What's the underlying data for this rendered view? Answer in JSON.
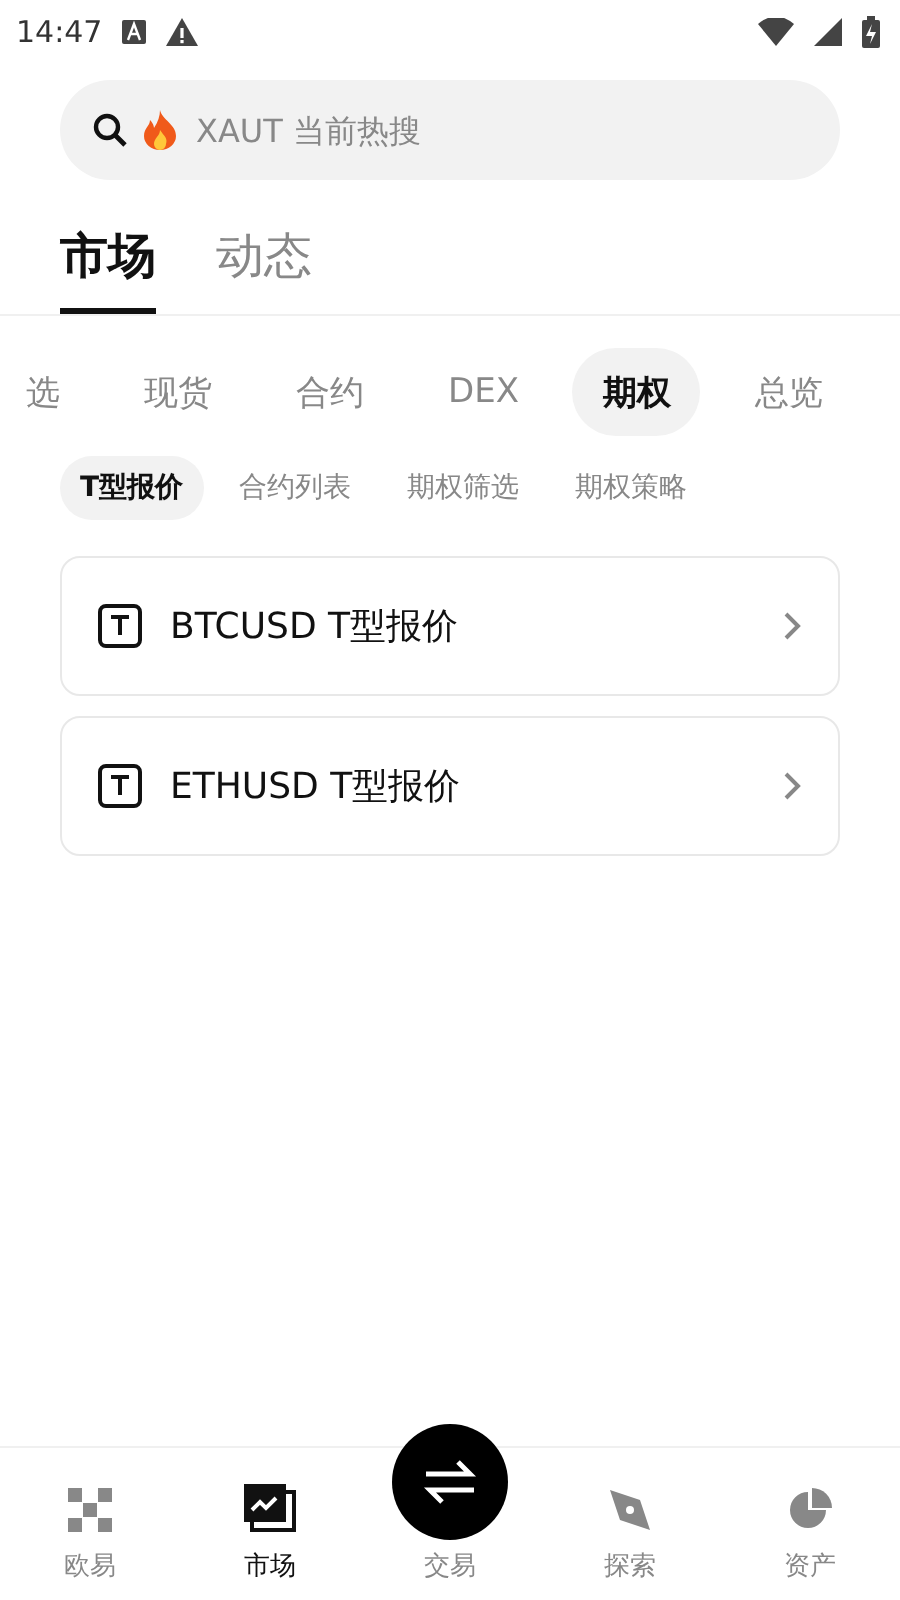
{
  "status_bar": {
    "time": "14:47"
  },
  "search": {
    "placeholder": "XAUT 当前热搜"
  },
  "main_tabs": [
    {
      "label": "市场",
      "selected": true
    },
    {
      "label": "动态",
      "selected": false
    }
  ],
  "categories": [
    {
      "label": "选",
      "selected": false
    },
    {
      "label": "现货",
      "selected": false
    },
    {
      "label": "合约",
      "selected": false
    },
    {
      "label": "DEX",
      "selected": false
    },
    {
      "label": "期权",
      "selected": true
    },
    {
      "label": "总览",
      "selected": false
    }
  ],
  "sub_tabs": [
    {
      "label": "T型报价",
      "selected": true
    },
    {
      "label": "合约列表",
      "selected": false
    },
    {
      "label": "期权筛选",
      "selected": false
    },
    {
      "label": "期权策略",
      "selected": false
    }
  ],
  "items": [
    {
      "label": "BTCUSD T型报价"
    },
    {
      "label": "ETHUSD T型报价"
    }
  ],
  "bottom_nav": [
    {
      "kind": "home",
      "label": "欧易",
      "selected": false
    },
    {
      "kind": "market",
      "label": "市场",
      "selected": true
    },
    {
      "kind": "trade",
      "label": "交易",
      "selected": false
    },
    {
      "kind": "explore",
      "label": "探索",
      "selected": false
    },
    {
      "kind": "assets",
      "label": "资产",
      "selected": false
    }
  ]
}
